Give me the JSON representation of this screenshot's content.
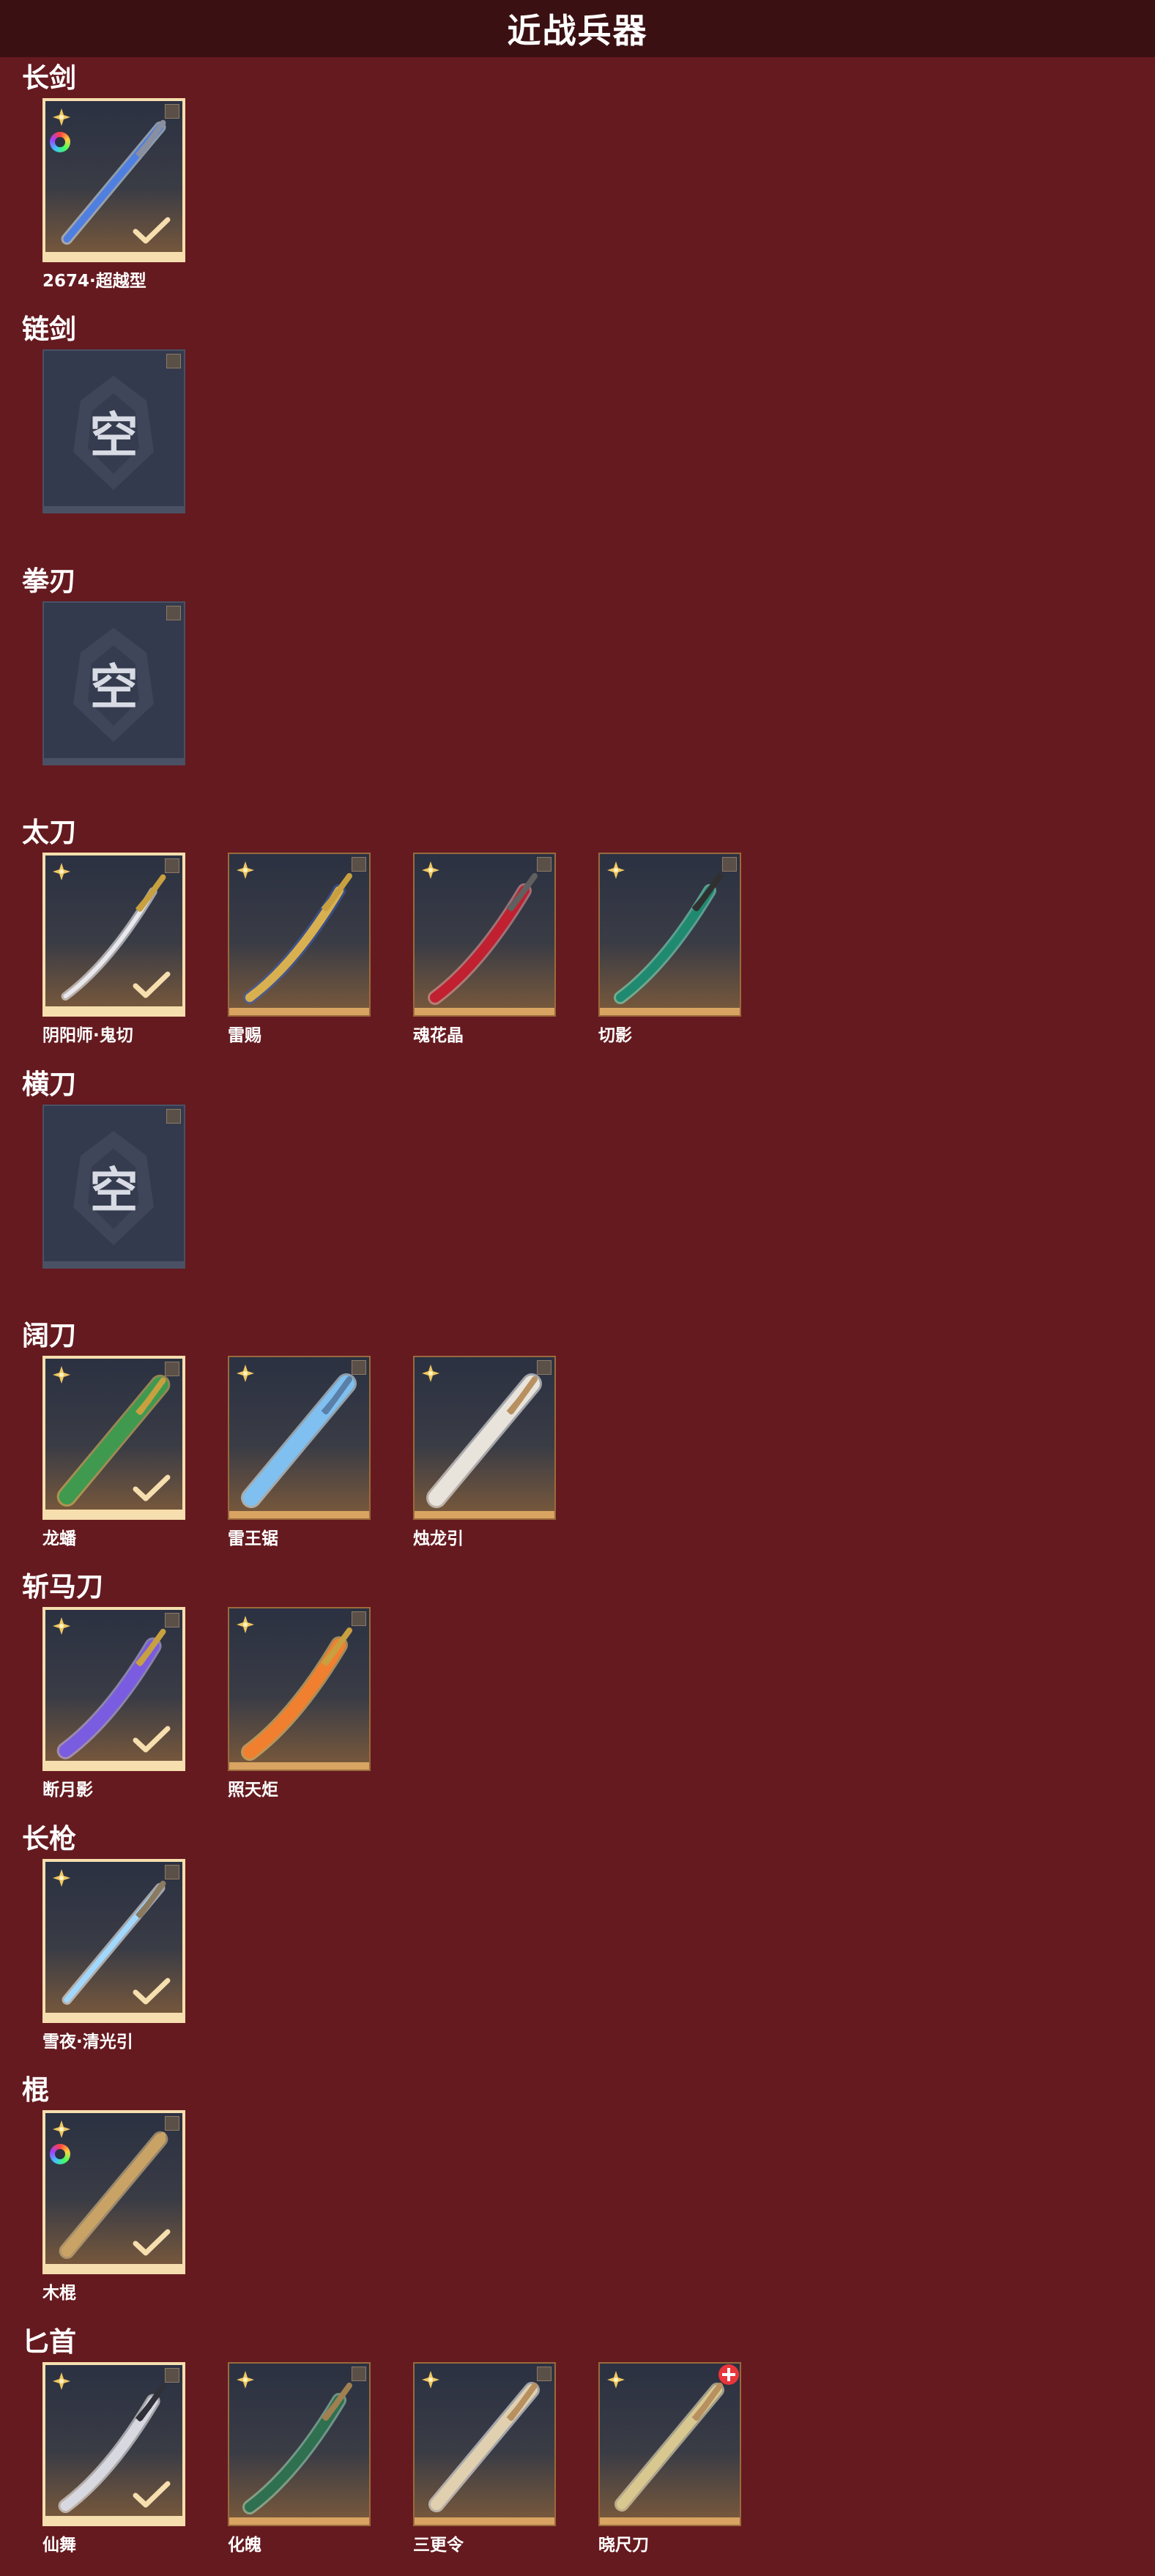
{
  "header": {
    "title": "近战兵器"
  },
  "empty_label": "空",
  "colors": {
    "background": "#651a1f",
    "header": "#3a1013",
    "card_border": "#9a6a3c",
    "selected_border": "#f6deae",
    "empty_card": "#343a4d",
    "badge_red": "#e8363b"
  },
  "sections": [
    {
      "title": "长剑",
      "items": [
        {
          "name": "2674·超越型",
          "selected": true,
          "rainbow": true,
          "icon": "blue-longsword-icon"
        }
      ]
    },
    {
      "title": "链剑",
      "items": [
        {
          "empty": true
        }
      ]
    },
    {
      "title": "拳刃",
      "items": [
        {
          "empty": true
        }
      ]
    },
    {
      "title": "太刀",
      "items": [
        {
          "name": "阴阳师·鬼切",
          "selected": true,
          "icon": "twin-katana-icon"
        },
        {
          "name": "雷赐",
          "icon": "gold-blue-katana-icon"
        },
        {
          "name": "魂花晶",
          "icon": "red-crystal-katana-icon"
        },
        {
          "name": "切影",
          "icon": "jade-katana-icon"
        }
      ]
    },
    {
      "title": "横刀",
      "items": [
        {
          "empty": true
        }
      ]
    },
    {
      "title": "阔刀",
      "items": [
        {
          "name": "龙蟠",
          "selected": true,
          "icon": "green-gold-broadsword-icon"
        },
        {
          "name": "雷王锯",
          "icon": "ice-broadsword-icon"
        },
        {
          "name": "烛龙引",
          "icon": "white-broadsword-icon"
        }
      ]
    },
    {
      "title": "斩马刀",
      "items": [
        {
          "name": "断月影",
          "selected": true,
          "icon": "purple-zhanmadao-icon"
        },
        {
          "name": "照天炬",
          "icon": "flame-zhanmadao-icon"
        }
      ]
    },
    {
      "title": "长枪",
      "items": [
        {
          "name": "雪夜·清光引",
          "selected": true,
          "icon": "ice-spear-icon"
        }
      ]
    },
    {
      "title": "棍",
      "items": [
        {
          "name": "木棍",
          "selected": true,
          "rainbow": true,
          "icon": "wooden-staff-icon"
        }
      ]
    },
    {
      "title": "匕首",
      "items": [
        {
          "name": "仙舞",
          "selected": true,
          "icon": "silver-dagger-icon"
        },
        {
          "name": "化魄",
          "icon": "jade-dagger-icon"
        },
        {
          "name": "三更令",
          "icon": "ornate-dagger-icon"
        },
        {
          "name": "晓尺刀",
          "badge": true,
          "icon": "gold-dagger-icon"
        }
      ]
    }
  ]
}
